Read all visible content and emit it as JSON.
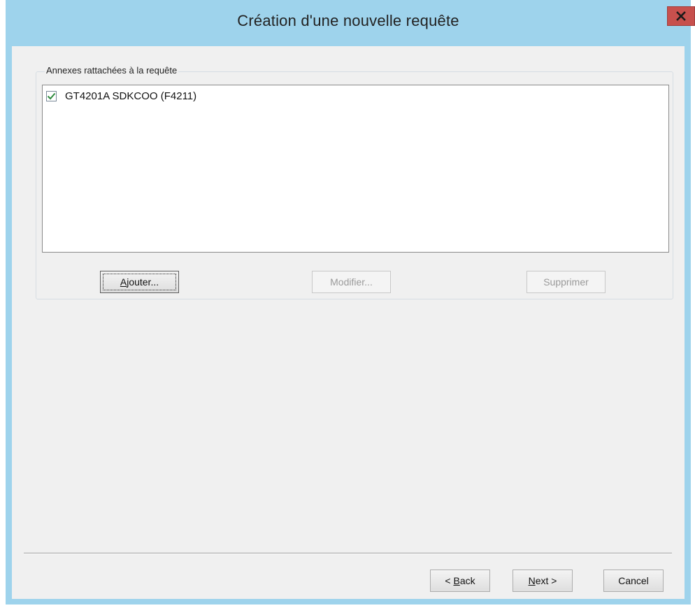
{
  "window": {
    "title": "Création d'une nouvelle requête",
    "close_glyph": "x"
  },
  "attachments": {
    "group_label": "Annexes rattachées à la requête",
    "items": [
      {
        "label": "GT4201A SDKCOO (F4211)",
        "checked": true
      }
    ],
    "add_button": {
      "pre": "",
      "mnemonic": "A",
      "post": "jouter..."
    },
    "modify_button": "Modifier...",
    "delete_button": "Supprimer"
  },
  "wizard": {
    "back_button": {
      "pre": "< ",
      "mnemonic": "B",
      "post": "ack"
    },
    "next_button": {
      "pre": "",
      "mnemonic": "N",
      "post": "ext >"
    },
    "cancel_button": "Cancel"
  },
  "colors": {
    "frame": "#9ed3ec",
    "close": "#c7504d",
    "client": "#f0f0f0",
    "check": "#2e8b3e"
  }
}
